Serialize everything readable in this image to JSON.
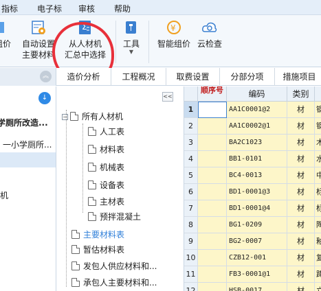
{
  "menu": {
    "items": [
      "指标",
      "电子标",
      "审核",
      "帮助"
    ]
  },
  "ribbon": {
    "partial_left": "组价",
    "buttons": [
      {
        "line1": "自动设置",
        "line2": "主要材料",
        "icon": "gear-table-icon"
      },
      {
        "line1": "从人材机",
        "line2": "汇总中选择",
        "icon": "sigma-table-icon"
      },
      {
        "line1": "工具",
        "line2": "",
        "icon": "wrench-icon",
        "dropdown": true
      },
      {
        "line1": "智能组价",
        "line2": "",
        "icon": "smart-price-icon"
      },
      {
        "line1": "云检查",
        "line2": "",
        "icon": "cloud-search-icon"
      }
    ]
  },
  "tabs": [
    "造价分析",
    "工程概况",
    "取费设置",
    "分部分项",
    "措施项目"
  ],
  "left_panel": {
    "items": [
      "学厕所改造...",
      "一小学厕所...",
      "",
      "",
      "机"
    ]
  },
  "tree": {
    "root": "所有人材机",
    "children": [
      "人工表",
      "材料表",
      "机械表",
      "设备表",
      "主材表",
      "预拌混凝土"
    ],
    "siblings": [
      "主要材料表",
      "暂估材料表",
      "发包人供应材料和...",
      "承包人主要材料和..."
    ],
    "collapse_label": "<<"
  },
  "grid": {
    "headers": {
      "seq": "顺序号",
      "code": "编码",
      "type": "类别"
    },
    "rows": [
      {
        "no": "1",
        "code": "AA1C0001@2",
        "type": "材",
        "extra": "钢"
      },
      {
        "no": "2",
        "code": "AA1C0002@1",
        "type": "材",
        "extra": "钢"
      },
      {
        "no": "3",
        "code": "BA2C1023",
        "type": "材",
        "extra": "木"
      },
      {
        "no": "4",
        "code": "BB1-0101",
        "type": "材",
        "extra": "水"
      },
      {
        "no": "5",
        "code": "BC4-0013",
        "type": "材",
        "extra": "中"
      },
      {
        "no": "6",
        "code": "BD1-0001@3",
        "type": "材",
        "extra": "标"
      },
      {
        "no": "7",
        "code": "BD1-0001@4",
        "type": "材",
        "extra": "标"
      },
      {
        "no": "8",
        "code": "BG1-0209",
        "type": "材",
        "extra": "陶"
      },
      {
        "no": "9",
        "code": "BG2-0007",
        "type": "材",
        "extra": "釉"
      },
      {
        "no": "10",
        "code": "CZB12-001",
        "type": "材",
        "extra": "复"
      },
      {
        "no": "11",
        "code": "FB3-0001@1",
        "type": "材",
        "extra": "蹲"
      },
      {
        "no": "12",
        "code": "HSB-0017",
        "type": "材",
        "extra": "立"
      }
    ]
  },
  "colors": {
    "accent": "#2f8ae6",
    "highlight_circle": "#e8303a",
    "cell_yellow": "#fdf6c9",
    "tree_highlight": "#2f7fd9"
  }
}
